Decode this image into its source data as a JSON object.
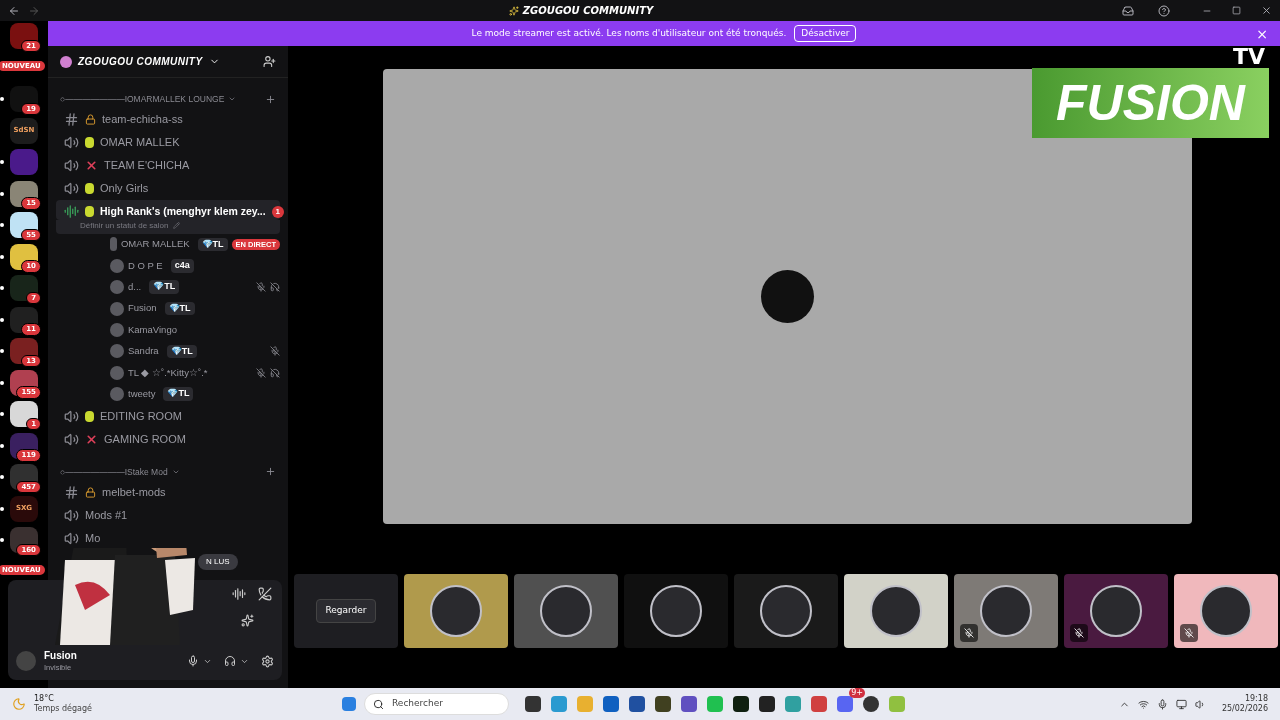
{
  "window": {
    "title": "ZGOUGOU COMMUNITY"
  },
  "banner": {
    "text": "Le mode streamer est activé. Les noms d'utilisateur ont été tronqués.",
    "button": "Désactiver",
    "close": "×"
  },
  "servers": [
    {
      "unread": false,
      "badge": "21"
    },
    {
      "unread": false,
      "badge": "NOUVEAU"
    },
    {
      "unread": true,
      "badge": "19"
    },
    {
      "unread": false,
      "label": "SdSN"
    },
    {
      "unread": true
    },
    {
      "unread": true,
      "badge": "15"
    },
    {
      "unread": true,
      "badge": "55"
    },
    {
      "unread": true,
      "badge": "10"
    },
    {
      "unread": true,
      "badge": "7"
    },
    {
      "unread": true,
      "badge": "11"
    },
    {
      "unread": true,
      "badge": "13"
    },
    {
      "unread": true,
      "badge": "155"
    },
    {
      "unread": true,
      "badge": "1"
    },
    {
      "unread": true,
      "badge": "119"
    },
    {
      "unread": true,
      "badge": "457"
    },
    {
      "unread": true,
      "label": "SXG"
    },
    {
      "unread": true,
      "badge": "160"
    },
    {
      "unread": false,
      "badge": "NOUVEAU"
    }
  ],
  "guild": {
    "name": "ZGOUGOU COMMUNITY"
  },
  "categories": [
    {
      "name": "○———————IOMARMALLEK LOUNGE",
      "channels": [
        {
          "kind": "text",
          "name": "team-echicha-ss"
        },
        {
          "kind": "voice",
          "name": "OMAR MALLEK",
          "allowed": true
        },
        {
          "kind": "voice",
          "name": "TEAM E'CHICHA",
          "allowed": false
        },
        {
          "kind": "voice",
          "name": "Only Girls",
          "allowed": true
        },
        {
          "kind": "voice",
          "name": "High Rank's (menghyr klem zey...",
          "allowed": true,
          "selected": true,
          "mention": "1",
          "status": "Définir un statut de salon",
          "members": [
            {
              "name": "OMAR MALLEK",
              "tag": "💎TL",
              "live": "EN DIRECT",
              "muted": false,
              "deafened": false
            },
            {
              "name": "D O P E",
              "tag": "c4a",
              "muted": false,
              "deafened": false
            },
            {
              "name": "d...",
              "tag": "💎TL",
              "muted": true,
              "deafened": true
            },
            {
              "name": "Fusion",
              "tag": "💎TL",
              "muted": false,
              "deafened": false
            },
            {
              "name": "KamaVingo",
              "muted": false,
              "deafened": false
            },
            {
              "name": "Sandra",
              "tag": "💎TL",
              "muted": true,
              "deafened": false
            },
            {
              "name": "TL ◆ ☆˚.*Kitty☆˚.*",
              "muted": true,
              "deafened": true
            },
            {
              "name": "tweety",
              "tag": "💎TL",
              "muted": false,
              "deafened": false
            }
          ]
        },
        {
          "kind": "voice",
          "name": "EDITING ROOM",
          "allowed": true
        },
        {
          "kind": "voice",
          "name": "GAMING ROOM",
          "allowed": false
        }
      ]
    },
    {
      "name": "○———————IStake Mod",
      "channels": [
        {
          "kind": "text",
          "name": "melbet-mods"
        },
        {
          "kind": "voice",
          "name": "Mods #1"
        },
        {
          "kind": "voice",
          "name": "Mo"
        }
      ]
    }
  ],
  "unread_pill": "N LUS",
  "user": {
    "name": "Fusion",
    "status": "Invisible"
  },
  "logo": {
    "top": "TV",
    "main": "FUSION"
  },
  "watch_button": "Regarder",
  "tiles": [
    {
      "color": "#b09a4c",
      "muted": false
    },
    {
      "color": "#505050",
      "muted": false
    },
    {
      "color": "#101010",
      "muted": false
    },
    {
      "color": "#1a1a1a",
      "muted": false
    },
    {
      "color": "#d2d2c8",
      "muted": false
    },
    {
      "color": "#7e7a76",
      "muted": true
    },
    {
      "color": "#4a1a40",
      "muted": true
    },
    {
      "color": "#f0b8bc",
      "muted": true
    }
  ],
  "taskbar": {
    "temp": "18°C",
    "weather": "Temps dégagé",
    "search": "Rechercher",
    "time": "19:18",
    "date": "25/02/2026",
    "discord_badge": "9+"
  }
}
